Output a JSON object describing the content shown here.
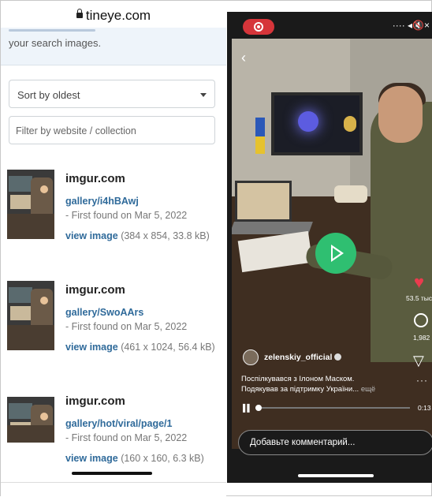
{
  "left": {
    "url": "tineye.com",
    "intro_text": "your search images.",
    "sort_label": "Sort by oldest",
    "filter_placeholder": "Filter by website / collection",
    "results": [
      {
        "domain": "imgur.com",
        "link": "gallery/i4hBAwj",
        "found": "- First found on Mar 5, 2022",
        "view_label": "view image",
        "view_meta": "(384 x 854, 33.8 kB)"
      },
      {
        "domain": "imgur.com",
        "link": "gallery/SwoAArs",
        "found": "- First found on Mar 5, 2022",
        "view_label": "view image",
        "view_meta": "(461 x 1024, 56.4 kB)"
      },
      {
        "domain": "imgur.com",
        "link": "gallery/hot/viral/page/1",
        "found": "- First found on Mar 5, 2022",
        "view_label": "view image",
        "view_meta": "(160 x 160, 6.3 kB)"
      }
    ]
  },
  "right": {
    "status_icons": "····  ◂🔇×",
    "back_glyph": "‹",
    "likes": "53.5 тыс.",
    "comments_count": "1,982",
    "username": "zelenskiy_official",
    "caption_line1": "Поспілкувався з Ілоном Маском.",
    "caption_line2": "Подякував за підтримку України...",
    "caption_more": "ещё",
    "progress": 0.02,
    "time": "0:13",
    "comment_placeholder": "Добавьте комментарий...",
    "colors": {
      "accent_play": "#2fbf71",
      "heart": "#ea3b4e",
      "rec": "#d6353a",
      "link": "#2f6a9a"
    }
  }
}
